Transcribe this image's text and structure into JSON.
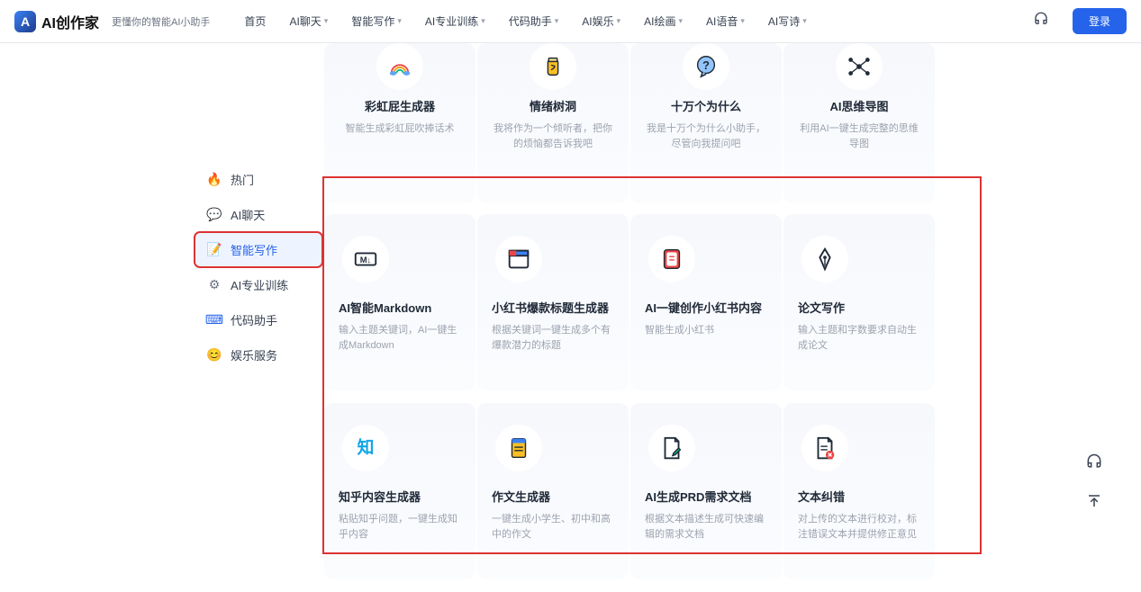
{
  "header": {
    "logo_text": "AI创作家",
    "subtitle": "更懂你的智能AI小助手",
    "nav": [
      "首页",
      "AI聊天",
      "智能写作",
      "AI专业训练",
      "代码助手",
      "AI娱乐",
      "AI绘画",
      "AI语音",
      "AI写诗"
    ],
    "nav_has_chev": [
      false,
      true,
      true,
      true,
      true,
      true,
      true,
      true,
      true
    ],
    "login": "登录"
  },
  "sidebar": {
    "items": [
      {
        "icon": "🔥",
        "label": "热门",
        "color": "#f97316"
      },
      {
        "icon": "💬",
        "label": "AI聊天",
        "color": "#3b82f6"
      },
      {
        "icon": "📝",
        "label": "智能写作",
        "color": "#2563eb",
        "active": true
      },
      {
        "icon": "⚙",
        "label": "AI专业训练",
        "color": "#6b7280"
      },
      {
        "icon": "⌨",
        "label": "代码助手",
        "color": "#2563eb"
      },
      {
        "icon": "😊",
        "label": "娱乐服务",
        "color": "#2563eb"
      }
    ]
  },
  "row1": [
    {
      "title": "彩虹屁生成器",
      "desc": "智能生成彩虹屁吹捧话术"
    },
    {
      "title": "情绪树洞",
      "desc": "我将作为一个倾听者，把你的烦恼都告诉我吧"
    },
    {
      "title": "十万个为什么",
      "desc": "我是十万个为什么小助手，尽管向我提问吧"
    },
    {
      "title": "AI思维导图",
      "desc": "利用AI一键生成完整的思维导图"
    }
  ],
  "row2": [
    {
      "title": "AI智能Markdown",
      "desc": "输入主题关键词，AI一键生成Markdown"
    },
    {
      "title": "小红书爆款标题生成器",
      "desc": "根据关键词一键生成多个有爆款潜力的标题"
    },
    {
      "title": "AI一键创作小红书内容",
      "desc": "智能生成小红书"
    },
    {
      "title": "论文写作",
      "desc": "输入主题和字数要求自动生成论文"
    }
  ],
  "row3": [
    {
      "title": "知乎内容生成器",
      "desc": "粘贴知乎问题，一键生成知乎内容"
    },
    {
      "title": "作文生成器",
      "desc": "一键生成小学生、初中和高中的作文"
    },
    {
      "title": "AI生成PRD需求文档",
      "desc": "根据文本描述生成可快速编辑的需求文档"
    },
    {
      "title": "文本纠错",
      "desc": "对上传的文本进行校对，标注错误文本并提供修正意见"
    }
  ],
  "icons": {
    "row1": [
      "rainbow",
      "cup",
      "question",
      "mindmap"
    ],
    "row2": [
      "markdown",
      "window",
      "note",
      "pen"
    ],
    "row3": [
      "zhi",
      "doc",
      "prd",
      "docx"
    ]
  }
}
